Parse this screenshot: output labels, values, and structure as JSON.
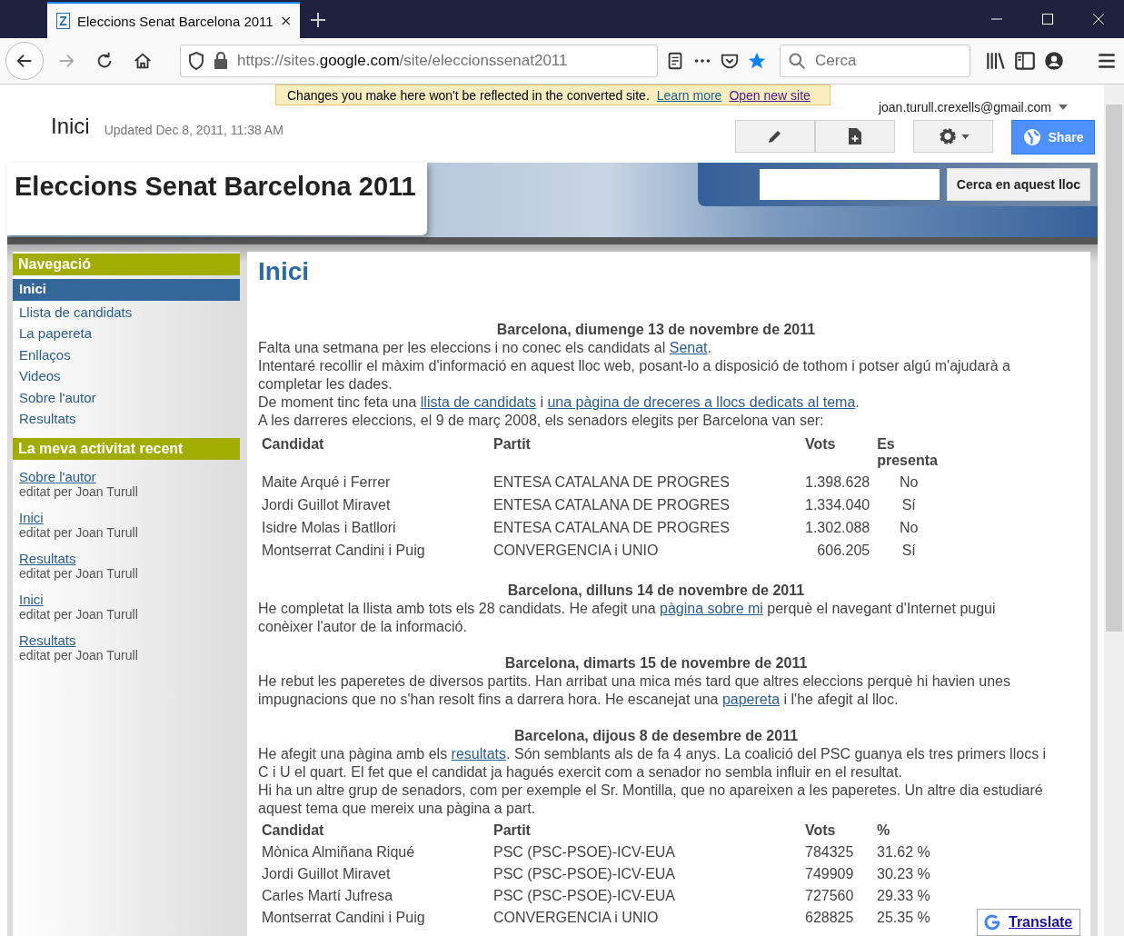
{
  "browser": {
    "favicon_letter": "Z",
    "tab_title": "Eleccions Senat Barcelona 2011",
    "url_pre": "https://sites.",
    "url_domain": "google.com",
    "url_post": "/site/eleccionssenat2011",
    "search_placeholder": "Cerca"
  },
  "banner": {
    "message": "Changes you make here won't be reflected in the converted site.",
    "links": [
      "Learn more",
      "Open new site"
    ]
  },
  "account": "joan.turull.crexells@gmail.com",
  "page_title": "Inici",
  "updated": "Updated Dec 8, 2011, 11:38 AM",
  "share": "Share",
  "site": {
    "title": "Eleccions Senat Barcelona 2011",
    "search_button": "Cerca en aquest lloc"
  },
  "sidebar": {
    "nav_title": "Navegació",
    "items": [
      {
        "label": "Inici",
        "selected": true
      },
      {
        "label": "Llista de candidats",
        "selected": false
      },
      {
        "label": "La papereta",
        "selected": false
      },
      {
        "label": "Enllaços",
        "selected": false
      },
      {
        "label": "Videos",
        "selected": false
      },
      {
        "label": "Sobre l'autor",
        "selected": false
      },
      {
        "label": "Resultats",
        "selected": false
      }
    ],
    "recent_title": "La meva activitat recent",
    "recent": [
      {
        "link": "Sobre l'autor",
        "by": "editat per Joan Turull"
      },
      {
        "link": "Inici",
        "by": "editat per Joan Turull"
      },
      {
        "link": "Resultats",
        "by": "editat per Joan Turull"
      },
      {
        "link": "Inici",
        "by": "editat per Joan Turull"
      },
      {
        "link": "Resultats",
        "by": "editat per Joan Turull"
      }
    ]
  },
  "content": {
    "heading": "Inici",
    "sections": [
      {
        "date": "Barcelona, diumenge 13 de novembre de 2011",
        "lines": [
          [
            {
              "kind": "text",
              "text": "Falta una setmana per les eleccions i no conec els candidats al "
            },
            {
              "kind": "link",
              "text": "Senat"
            },
            {
              "kind": "text",
              "text": "."
            }
          ],
          [
            {
              "kind": "text",
              "text": "Intentaré recollir el màxim d'informació en aquest lloc web, posant-lo a disposició de tothom i potser algú m'ajudarà a completar les dades."
            }
          ],
          [
            {
              "kind": "text",
              "text": "De moment tinc feta una "
            },
            {
              "kind": "link",
              "text": "llista de candidats"
            },
            {
              "kind": "text",
              "text": " i "
            },
            {
              "kind": "link",
              "text": "una pàgina de dreceres a llocs dedicats al tema"
            },
            {
              "kind": "text",
              "text": "."
            }
          ],
          [
            {
              "kind": "text",
              "text": "A les darreres eleccions, el 9 de març 2008, els senadors elegits per Barcelona van ser:"
            }
          ]
        ],
        "table": {
          "columns": [
            "Candidat",
            "Partit",
            "Vots",
            "Es presenta"
          ],
          "rows": [
            [
              "Maite Arqué i Ferrer",
              "ENTESA CATALANA DE PROGRES",
              "1.398.628",
              "No"
            ],
            [
              "Jordi Guillot Miravet",
              "ENTESA CATALANA DE PROGRES",
              "1.334.040",
              "Sí"
            ],
            [
              "Isidre Molas i Batllori",
              "ENTESA CATALANA DE PROGRES",
              "1.302.088",
              "No"
            ],
            [
              "Montserrat Candini i Puig",
              "CONVERGENCIA i UNIO",
              "606.205",
              "Sí"
            ]
          ]
        }
      },
      {
        "date": "Barcelona, dilluns 14 de novembre de 2011",
        "lines": [
          [
            {
              "kind": "text",
              "text": "He completat la llista amb tots els 28 candidats. He afegit una "
            },
            {
              "kind": "link",
              "text": "pàgina sobre mi"
            },
            {
              "kind": "text",
              "text": " perquè el navegant d'Internet pugui conèixer l'autor de la informació."
            }
          ]
        ]
      },
      {
        "date": "Barcelona, dimarts 15 de novembre de 2011",
        "lines": [
          [
            {
              "kind": "text",
              "text": "He rebut les paperetes de diversos partits. Han arribat una mica més tard que altres eleccions perquè hi havien unes impugnacions que no s'han resolt fins a darrera hora. He escanejat una "
            },
            {
              "kind": "link",
              "text": "papereta"
            },
            {
              "kind": "text",
              "text": " i l'he afegit al lloc."
            }
          ]
        ]
      },
      {
        "date": "Barcelona, dijous 8 de desembre de 2011",
        "lines": [
          [
            {
              "kind": "text",
              "text": "He afegit una pàgina amb els "
            },
            {
              "kind": "link",
              "text": "resultats"
            },
            {
              "kind": "text",
              "text": ". Són semblants als de fa 4 anys. La coalició del PSC guanya els tres primers llocs i C i U el quart. El fet que el candidat ja hagués exercit com a senador no sembla influir en el resultat."
            }
          ],
          [
            {
              "kind": "text",
              "text": "Hi ha un altre grup de senadors, com per exemple el Sr. Montilla, que no apareixen a les paperetes. Un altre dia estudiaré aquest tema que mereix una pàgina a part."
            }
          ]
        ],
        "table": {
          "columns": [
            "Candidat",
            "Partit",
            "Vots",
            "%"
          ],
          "rows": [
            [
              "Mònica Almiñana Riqué",
              "PSC (PSC-PSOE)-ICV-EUA",
              "784325",
              "31.62 %"
            ],
            [
              "Jordi Guillot Miravet",
              "PSC (PSC-PSOE)-ICV-EUA",
              "749909",
              "30.23 %"
            ],
            [
              "Carles Martí Jufresa",
              "PSC (PSC-PSOE)-ICV-EUA",
              "727560",
              "29.33 %"
            ],
            [
              "Montserrat Candini i Puig",
              "CONVERGENCIA i UNIO",
              "628825",
              "25.35 %"
            ]
          ]
        }
      }
    ]
  },
  "translate": "Translate"
}
